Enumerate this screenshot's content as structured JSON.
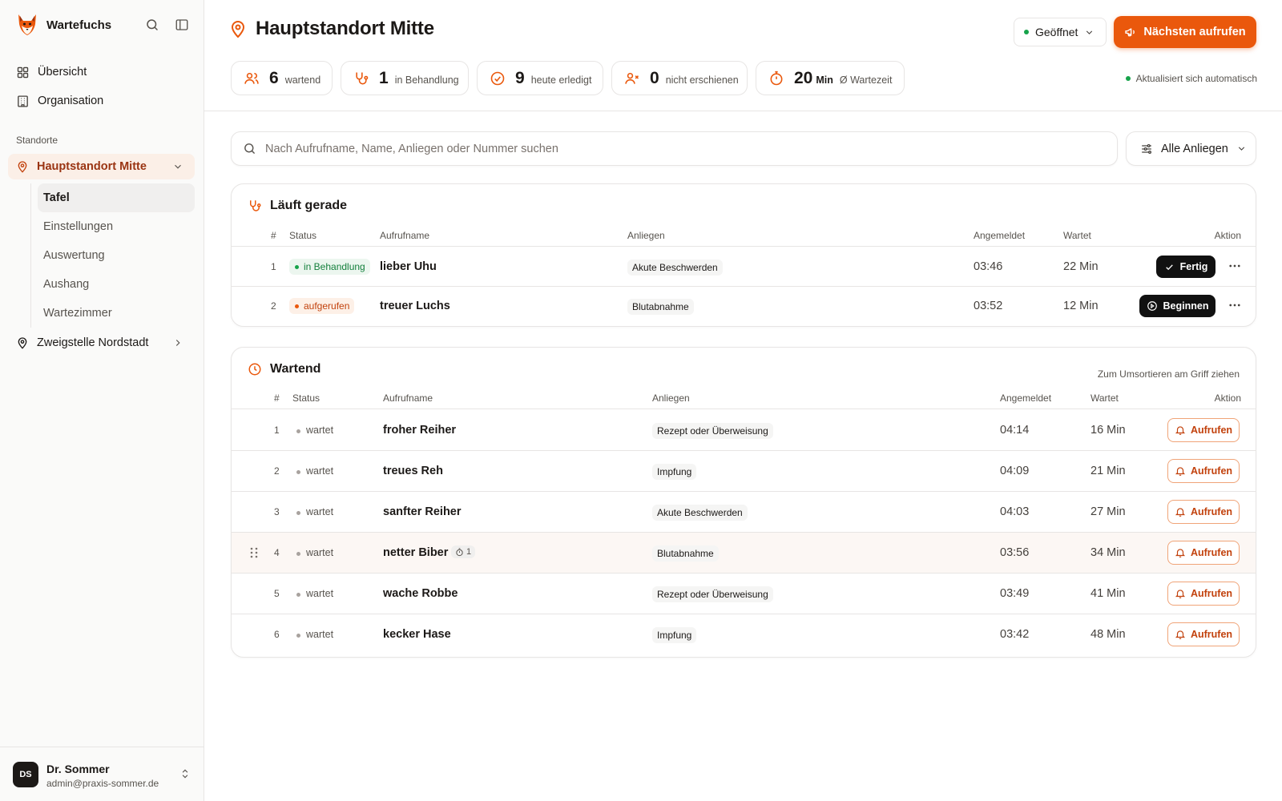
{
  "app": {
    "name": "Wartefuchs"
  },
  "sidebar": {
    "nav": [
      {
        "label": "Übersicht",
        "icon": "grid-icon"
      },
      {
        "label": "Organisation",
        "icon": "building-icon"
      }
    ],
    "section_label": "Standorte",
    "locations": [
      {
        "label": "Hauptstandort Mitte",
        "active": true,
        "expanded": true
      },
      {
        "label": "Zweigstelle Nordstadt",
        "active": false,
        "expanded": false
      }
    ],
    "subnav": [
      {
        "label": "Tafel",
        "active": true
      },
      {
        "label": "Einstellungen",
        "active": false
      },
      {
        "label": "Auswertung",
        "active": false
      },
      {
        "label": "Aushang",
        "active": false
      },
      {
        "label": "Wartezimmer",
        "active": false
      }
    ],
    "user": {
      "initials": "DS",
      "name": "Dr. Sommer",
      "email": "admin@praxis-sommer.de"
    }
  },
  "header": {
    "title": "Hauptstandort Mitte",
    "status": "Geöffnet",
    "primary_action": "Nächsten aufrufen",
    "stats": [
      {
        "value": "6",
        "unit": "",
        "label": "wartend",
        "icon": "users-icon"
      },
      {
        "value": "1",
        "unit": "",
        "label": "in Behandlung",
        "icon": "stethoscope-icon"
      },
      {
        "value": "9",
        "unit": "",
        "label": "heute erledigt",
        "icon": "check-circle-icon"
      },
      {
        "value": "0",
        "unit": "",
        "label": "nicht erschienen",
        "icon": "user-x-icon"
      },
      {
        "value": "20",
        "unit": "Min",
        "label": "Ø Wartezeit",
        "icon": "timer-icon"
      }
    ],
    "auto_refresh": "Aktualisiert sich automatisch"
  },
  "search": {
    "placeholder": "Nach Aufrufname, Name, Anliegen oder Nummer suchen",
    "value": ""
  },
  "filter": {
    "label": "Alle Anliegen"
  },
  "active": {
    "title": "Läuft gerade",
    "columns": {
      "num": "#",
      "status": "Status",
      "name": "Aufrufname",
      "concern": "Anliegen",
      "registered": "Angemeldet",
      "waits": "Wartet",
      "action": "Aktion"
    },
    "rows": [
      {
        "num": "1",
        "status": "in Behandlung",
        "status_color": "green",
        "name": "lieber Uhu",
        "concern": "Akute Beschwerden",
        "registered": "03:46",
        "waits": "22 Min",
        "action": "Fertig"
      },
      {
        "num": "2",
        "status": "aufgerufen",
        "status_color": "orange",
        "name": "treuer Luchs",
        "concern": "Blutabnahme",
        "registered": "03:52",
        "waits": "12 Min",
        "action": "Beginnen"
      }
    ]
  },
  "waiting": {
    "title": "Wartend",
    "hint": "Zum Umsortieren am Griff ziehen",
    "columns": {
      "num": "#",
      "status": "Status",
      "name": "Aufrufname",
      "concern": "Anliegen",
      "registered": "Angemeldet",
      "waits": "Wartet",
      "action": "Aktion"
    },
    "rows": [
      {
        "num": "1",
        "status": "wartet",
        "name": "froher Reiher",
        "concern": "Rezept oder Überweisung",
        "registered": "04:14",
        "waits": "16 Min",
        "action": "Aufrufen"
      },
      {
        "num": "2",
        "status": "wartet",
        "name": "treues Reh",
        "concern": "Impfung",
        "registered": "04:09",
        "waits": "21 Min",
        "action": "Aufrufen"
      },
      {
        "num": "3",
        "status": "wartet",
        "name": "sanfter Reiher",
        "concern": "Akute Beschwerden",
        "registered": "04:03",
        "waits": "27 Min",
        "action": "Aufrufen"
      },
      {
        "num": "4",
        "status": "wartet",
        "name": "netter Biber",
        "badge": "1",
        "concern": "Blutabnahme",
        "registered": "03:56",
        "waits": "34 Min",
        "action": "Aufrufen",
        "highlighted": true
      },
      {
        "num": "5",
        "status": "wartet",
        "name": "wache Robbe",
        "concern": "Rezept oder Überweisung",
        "registered": "03:49",
        "waits": "41 Min",
        "action": "Aufrufen"
      },
      {
        "num": "6",
        "status": "wartet",
        "name": "kecker Hase",
        "concern": "Impfung",
        "registered": "03:42",
        "waits": "48 Min",
        "action": "Aufrufen"
      }
    ]
  },
  "colors": {
    "accent": "#ea580c",
    "accent_dark": "#c2410c",
    "success": "#16a34a",
    "sidebar_bg": "#fafaf9",
    "border": "#e7e5e4"
  }
}
